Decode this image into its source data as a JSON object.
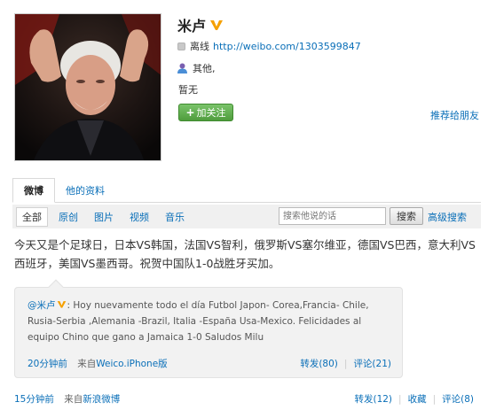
{
  "profile": {
    "name": "米卢",
    "status_label": "离线",
    "weibo_url": "http://weibo.com/1303599847",
    "location": "其他,",
    "intro": "暂无",
    "follow_label": "加关注",
    "recommend_label": "推荐给朋友"
  },
  "tabs": [
    {
      "label": "微博"
    },
    {
      "label": "他的资料"
    }
  ],
  "filters": [
    "全部",
    "原创",
    "图片",
    "视频",
    "音乐"
  ],
  "search": {
    "placeholder": "搜索他说的话",
    "button": "搜索",
    "advanced": "高级搜索"
  },
  "post": {
    "text": "今天又是个足球日，日本VS韩国，法国VS智利，俄罗斯VS塞尔维亚，德国VS巴西，意大利VS西班牙，美国VS墨西哥。祝贺中国队1-0战胜牙买加。",
    "repost": {
      "author": "@米卢",
      "text": ": Hoy nuevamente todo el día Futbol Japon- Corea,Francia- Chile, Rusia-Serbia ,Alemania -Brazil, Italia -España Usa-Mexico. Felicidades al equipo Chino que gano a Jamaica 1-0 Saludos Milu",
      "time": "20分钟前",
      "source_prefix": "来自",
      "source": "Weico.iPhone版",
      "repost_count": "转发(80)",
      "comment_count": "评论(21)"
    },
    "time": "15分钟前",
    "source_prefix": "来自",
    "source": "新浪微博",
    "repost_count": "转发(12)",
    "favorite": "收藏",
    "comment_count": "评论(8)"
  },
  "colors": {
    "link": "#0a6fb8",
    "follow_button": "#4f9d3d",
    "verified_badge": "#f5a000"
  }
}
